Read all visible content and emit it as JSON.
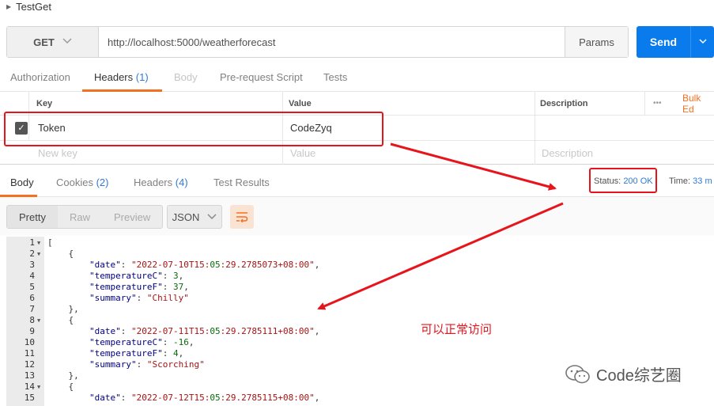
{
  "request": {
    "title": "TestGet",
    "method": "GET",
    "url": "http://localhost:5000/weatherforecast",
    "params_label": "Params",
    "send_label": "Send"
  },
  "request_tabs": [
    {
      "label": "Authorization"
    },
    {
      "label": "Headers",
      "count": "(1)"
    },
    {
      "label": "Body"
    },
    {
      "label": "Pre-request Script"
    },
    {
      "label": "Tests"
    }
  ],
  "headers_table": {
    "col_key": "Key",
    "col_value": "Value",
    "col_description": "Description",
    "more": "•••",
    "bulk_edit": "Bulk Ed",
    "rows": [
      {
        "key": "Token",
        "value": "CodeZyq",
        "checked": true
      }
    ],
    "new_key_placeholder": "New key",
    "value_placeholder": "Value",
    "description_placeholder": "Description"
  },
  "response_tabs": [
    {
      "label": "Body"
    },
    {
      "label": "Cookies",
      "count": "(2)"
    },
    {
      "label": "Headers",
      "count": "(4)"
    },
    {
      "label": "Test Results"
    }
  ],
  "response": {
    "status_label": "Status:",
    "status_value": "200 OK",
    "time_label": "Time:",
    "time_value": "33 m"
  },
  "view_modes": [
    "Pretty",
    "Raw",
    "Preview"
  ],
  "format": "JSON",
  "code_lines": [
    {
      "n": "1",
      "fold": true,
      "text": "["
    },
    {
      "n": "2",
      "fold": true,
      "text": "    {"
    },
    {
      "n": "3",
      "text": "        \"date\": \"2022-07-10T15:05:29.2785073+08:00\","
    },
    {
      "n": "4",
      "text": "        \"temperatureC\": 3,"
    },
    {
      "n": "5",
      "text": "        \"temperatureF\": 37,"
    },
    {
      "n": "6",
      "text": "        \"summary\": \"Chilly\""
    },
    {
      "n": "7",
      "text": "    },"
    },
    {
      "n": "8",
      "fold": true,
      "text": "    {"
    },
    {
      "n": "9",
      "text": "        \"date\": \"2022-07-11T15:05:29.2785111+08:00\","
    },
    {
      "n": "10",
      "text": "        \"temperatureC\": -16,"
    },
    {
      "n": "11",
      "text": "        \"temperatureF\": 4,"
    },
    {
      "n": "12",
      "text": "        \"summary\": \"Scorching\""
    },
    {
      "n": "13",
      "text": "    },"
    },
    {
      "n": "14",
      "fold": true,
      "text": "    {"
    },
    {
      "n": "15",
      "text": "        \"date\": \"2022-07-12T15:05:29.2785115+08:00\","
    }
  ],
  "annotation": "可以正常访问",
  "watermark": "Code综艺圈",
  "colors": {
    "accent": "#f47023",
    "send": "#097bed",
    "highlight": "#e8141c",
    "link": "#2f7bd1"
  }
}
